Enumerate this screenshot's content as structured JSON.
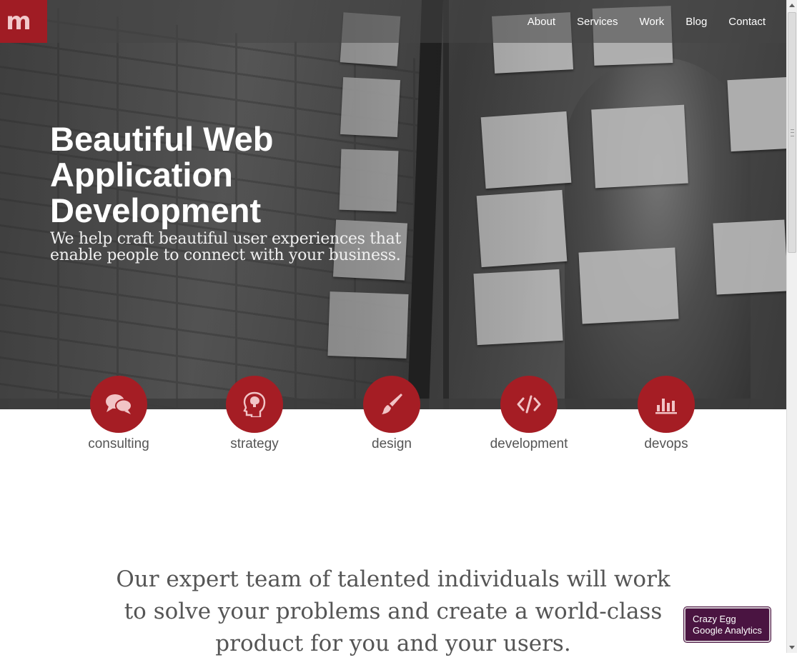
{
  "logo": {
    "text": "m"
  },
  "nav": {
    "items": [
      "About",
      "Services",
      "Work",
      "Blog",
      "Contact"
    ]
  },
  "hero": {
    "headline": "Beautiful Web Application Development",
    "subhead": "We help craft beautiful user experiences that enable people to connect with your business."
  },
  "services": [
    {
      "label": "consulting",
      "icon": "speech-bubbles-icon"
    },
    {
      "label": "strategy",
      "icon": "head-brain-icon"
    },
    {
      "label": "design",
      "icon": "paintbrush-icon"
    },
    {
      "label": "development",
      "icon": "code-icon"
    },
    {
      "label": "devops",
      "icon": "bar-chart-icon"
    }
  ],
  "tagline": "Our expert team of talented individuals will work to solve your problems and create a world-class product for you and your users.",
  "widget": {
    "line1": "Crazy Egg",
    "line2": "Google Analytics"
  },
  "colors": {
    "accent": "#a51d24",
    "widget_bg": "#4a1441",
    "text": "#555555"
  }
}
